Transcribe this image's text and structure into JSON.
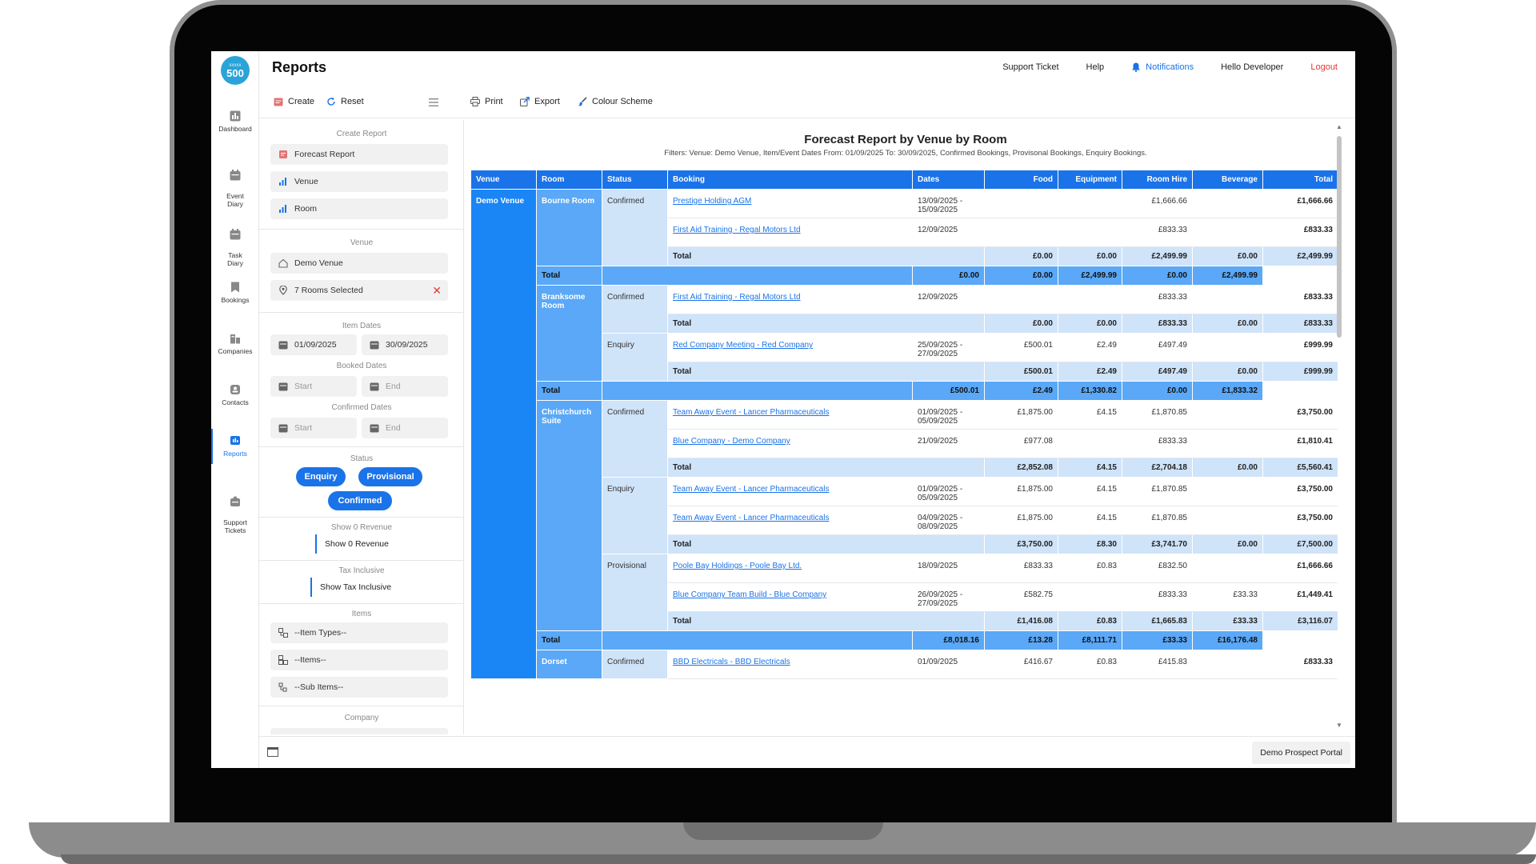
{
  "app": {
    "logo_top": "xxxxx",
    "logo_main": "500",
    "page_title": "Reports"
  },
  "rail": [
    {
      "label": "Dashboard"
    },
    {
      "label": "Event\nDiary"
    },
    {
      "label": "Task\nDiary"
    },
    {
      "label": "Bookings"
    },
    {
      "label": "Companies"
    },
    {
      "label": "Contacts"
    },
    {
      "label": "Reports"
    },
    {
      "label": "Support\nTickets"
    }
  ],
  "topnav": {
    "support": "Support Ticket",
    "help": "Help",
    "notifications": "Notifications",
    "user": "Hello Developer",
    "logout": "Logout"
  },
  "toolbar": {
    "create": "Create",
    "reset": "Reset",
    "print": "Print",
    "export": "Export",
    "colour": "Colour Scheme"
  },
  "panel": {
    "create_report_label": "Create Report",
    "report_types": [
      "Forecast Report",
      "Venue",
      "Room"
    ],
    "venue_label": "Venue",
    "venue_value": "Demo Venue",
    "rooms_value": "7 Rooms Selected",
    "item_dates_label": "Item Dates",
    "item_date_from": "01/09/2025",
    "item_date_to": "30/09/2025",
    "booked_dates_label": "Booked Dates",
    "booked_start_placeholder": "Start",
    "booked_end_placeholder": "End",
    "confirmed_dates_label": "Confirmed Dates",
    "confirmed_start_placeholder": "Start",
    "confirmed_end_placeholder": "End",
    "status_label": "Status",
    "status_enquiry": "Enquiry",
    "status_provisional": "Provisional",
    "status_confirmed": "Confirmed",
    "show0_label": "Show 0 Revenue",
    "show0_toggle": "Show 0 Revenue",
    "tax_label": "Tax Inclusive",
    "tax_toggle": "Show Tax Inclusive",
    "items_label": "Items",
    "item_types": "--Item Types--",
    "items": "--Items--",
    "sub_items": "--Sub Items--",
    "company_label": "Company"
  },
  "report": {
    "title": "Forecast Report by Venue by Room",
    "filters": "Filters: Venue: Demo Venue, Item/Event Dates From: 01/09/2025 To: 30/09/2025, Confirmed Bookings, Provisonal Bookings, Enquiry Bookings.",
    "columns": [
      "Venue",
      "Room",
      "Status",
      "Booking",
      "Dates",
      "Food",
      "Equipment",
      "Room Hire",
      "Beverage",
      "Total"
    ],
    "venue": "Demo Venue",
    "total_label": "Total",
    "rooms": [
      {
        "name": "Bourne Room",
        "statuses": [
          {
            "status": "Confirmed",
            "rows": [
              {
                "booking": "Prestige Holding AGM",
                "dates": "13/09/2025 - 15/09/2025",
                "food": "",
                "equipment": "",
                "room_hire": "£1,666.66",
                "beverage": "",
                "total": "£1,666.66"
              },
              {
                "booking": "First Aid Training - Regal Motors Ltd",
                "dates": "12/09/2025",
                "food": "",
                "equipment": "",
                "room_hire": "£833.33",
                "beverage": "",
                "total": "£833.33"
              }
            ],
            "total": {
              "food": "£0.00",
              "equipment": "£0.00",
              "room_hire": "£2,499.99",
              "beverage": "£0.00",
              "total": "£2,499.99"
            }
          }
        ],
        "total": {
          "food": "£0.00",
          "equipment": "£0.00",
          "room_hire": "£2,499.99",
          "beverage": "£0.00",
          "total": "£2,499.99"
        }
      },
      {
        "name": "Branksome Room",
        "statuses": [
          {
            "status": "Confirmed",
            "rows": [
              {
                "booking": "First Aid Training - Regal Motors Ltd",
                "dates": "12/09/2025",
                "food": "",
                "equipment": "",
                "room_hire": "£833.33",
                "beverage": "",
                "total": "£833.33"
              }
            ],
            "total": {
              "food": "£0.00",
              "equipment": "£0.00",
              "room_hire": "£833.33",
              "beverage": "£0.00",
              "total": "£833.33"
            }
          },
          {
            "status": "Enquiry",
            "rows": [
              {
                "booking": "Red Company Meeting - Red Company",
                "dates": "25/09/2025 - 27/09/2025",
                "food": "£500.01",
                "equipment": "£2.49",
                "room_hire": "£497.49",
                "beverage": "",
                "total": "£999.99"
              }
            ],
            "total": {
              "food": "£500.01",
              "equipment": "£2.49",
              "room_hire": "£497.49",
              "beverage": "£0.00",
              "total": "£999.99"
            }
          }
        ],
        "total": {
          "food": "£500.01",
          "equipment": "£2.49",
          "room_hire": "£1,330.82",
          "beverage": "£0.00",
          "total": "£1,833.32"
        }
      },
      {
        "name": "Christchurch Suite",
        "statuses": [
          {
            "status": "Confirmed",
            "rows": [
              {
                "booking": "Team Away Event - Lancer Pharmaceuticals",
                "dates": "01/09/2025 - 05/09/2025",
                "food": "£1,875.00",
                "equipment": "£4.15",
                "room_hire": "£1,870.85",
                "beverage": "",
                "total": "£3,750.00"
              },
              {
                "booking": "Blue Company - Demo Company",
                "dates": "21/09/2025",
                "food": "£977.08",
                "equipment": "",
                "room_hire": "£833.33",
                "beverage": "",
                "total": "£1,810.41"
              }
            ],
            "total": {
              "food": "£2,852.08",
              "equipment": "£4.15",
              "room_hire": "£2,704.18",
              "beverage": "£0.00",
              "total": "£5,560.41"
            }
          },
          {
            "status": "Enquiry",
            "rows": [
              {
                "booking": "Team Away Event - Lancer Pharmaceuticals",
                "dates": "01/09/2025 - 05/09/2025",
                "food": "£1,875.00",
                "equipment": "£4.15",
                "room_hire": "£1,870.85",
                "beverage": "",
                "total": "£3,750.00"
              },
              {
                "booking": "Team Away Event - Lancer Pharmaceuticals",
                "dates": "04/09/2025 - 08/09/2025",
                "food": "£1,875.00",
                "equipment": "£4.15",
                "room_hire": "£1,870.85",
                "beverage": "",
                "total": "£3,750.00"
              }
            ],
            "total": {
              "food": "£3,750.00",
              "equipment": "£8.30",
              "room_hire": "£3,741.70",
              "beverage": "£0.00",
              "total": "£7,500.00"
            }
          },
          {
            "status": "Provisional",
            "rows": [
              {
                "booking": "Poole Bay Holdings - Poole Bay Ltd.",
                "dates": "18/09/2025",
                "food": "£833.33",
                "equipment": "£0.83",
                "room_hire": "£832.50",
                "beverage": "",
                "total": "£1,666.66"
              },
              {
                "booking": "Blue Company Team Build - Blue Company",
                "dates": "26/09/2025 - 27/09/2025",
                "food": "£582.75",
                "equipment": "",
                "room_hire": "£833.33",
                "beverage": "£33.33",
                "total": "£1,449.41"
              }
            ],
            "total": {
              "food": "£1,416.08",
              "equipment": "£0.83",
              "room_hire": "£1,665.83",
              "beverage": "£33.33",
              "total": "£3,116.07"
            }
          }
        ],
        "total": {
          "food": "£8,018.16",
          "equipment": "£13.28",
          "room_hire": "£8,111.71",
          "beverage": "£33.33",
          "total": "£16,176.48"
        }
      },
      {
        "name": "Dorset",
        "statuses": [
          {
            "status": "Confirmed",
            "rows": [
              {
                "booking": "BBD Electricals - BBD Electricals",
                "dates": "01/09/2025",
                "food": "£416.67",
                "equipment": "£0.83",
                "room_hire": "£415.83",
                "beverage": "",
                "total": "£833.33"
              }
            ]
          }
        ]
      }
    ]
  },
  "footer": {
    "portal": "Demo Prospect Portal"
  },
  "colors": {
    "accent": "#1a73e8",
    "venue_col": "#1a85f5",
    "room_col": "#5aa8f7",
    "status_col": "#cfe3f9",
    "logout": "#e53935"
  }
}
